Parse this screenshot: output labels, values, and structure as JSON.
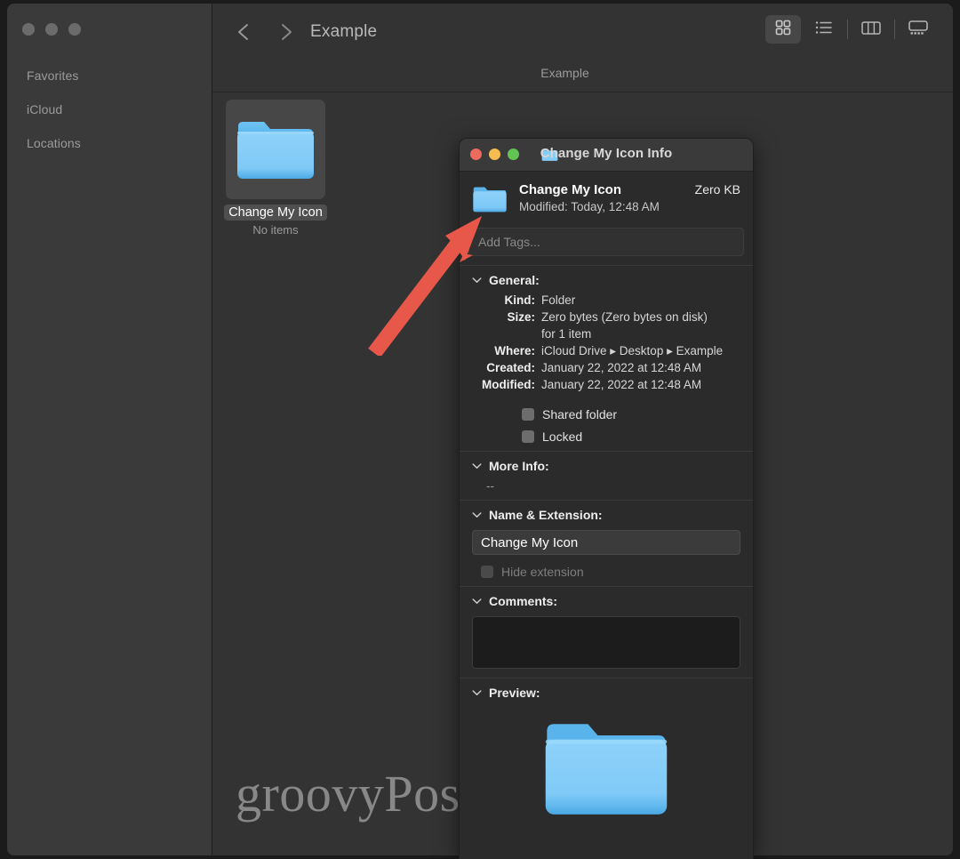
{
  "finder": {
    "window_title": "Example",
    "path_bar": "Example",
    "nav": {
      "back_icon": "chevron-left-icon",
      "forward_icon": "chevron-right-icon"
    },
    "view_modes": [
      {
        "name": "icon-view",
        "icon": "grid-icon",
        "active": true
      },
      {
        "name": "list-view",
        "icon": "list-icon",
        "active": false
      },
      {
        "name": "column-view",
        "icon": "columns-icon",
        "active": false
      },
      {
        "name": "gallery-view",
        "icon": "gallery-icon",
        "active": false
      }
    ],
    "sidebar": {
      "sections": [
        {
          "label": "Favorites"
        },
        {
          "label": "iCloud"
        },
        {
          "label": "Locations"
        }
      ]
    },
    "files": [
      {
        "name": "Change My Icon",
        "subtitle": "No items",
        "icon": "folder-icon",
        "selected": true
      }
    ]
  },
  "info_window": {
    "title": "Change My Icon Info",
    "title_icon": "folder-icon",
    "traffic_lights": {
      "close_color": "#ed6a5e",
      "minimize_color": "#f5bd4f",
      "zoom_color": "#61c454"
    },
    "header": {
      "name": "Change My Icon",
      "modified": "Modified: Today, 12:48 AM",
      "size": "Zero KB",
      "icon": "folder-icon"
    },
    "tags_placeholder": "Add Tags...",
    "sections": {
      "general": {
        "label": "General:",
        "rows": [
          {
            "key": "Kind:",
            "value": "Folder"
          },
          {
            "key": "Size:",
            "value": "Zero bytes (Zero bytes on disk)"
          },
          {
            "key": "",
            "value": "for 1 item"
          },
          {
            "key": "Where:",
            "value": "iCloud Drive ▸ Desktop ▸ Example"
          },
          {
            "key": "Created:",
            "value": "January 22, 2022 at 12:48 AM"
          },
          {
            "key": "Modified:",
            "value": "January 22, 2022 at 12:48 AM"
          }
        ],
        "checkboxes": [
          {
            "label": "Shared folder",
            "checked": false,
            "disabled": false
          },
          {
            "label": "Locked",
            "checked": false,
            "disabled": false
          }
        ]
      },
      "more_info": {
        "label": "More Info:",
        "value": "--"
      },
      "name_extension": {
        "label": "Name & Extension:",
        "field_value": "Change My Icon",
        "hide_extension_label": "Hide extension",
        "hide_extension_checked": false
      },
      "comments": {
        "label": "Comments:",
        "value": ""
      },
      "preview": {
        "label": "Preview:",
        "icon": "folder-icon"
      }
    }
  },
  "annotation": {
    "arrow_color": "#e8584a",
    "points_to": "info-window-folder-icon"
  },
  "watermark": {
    "text": "groovyPost.com"
  }
}
